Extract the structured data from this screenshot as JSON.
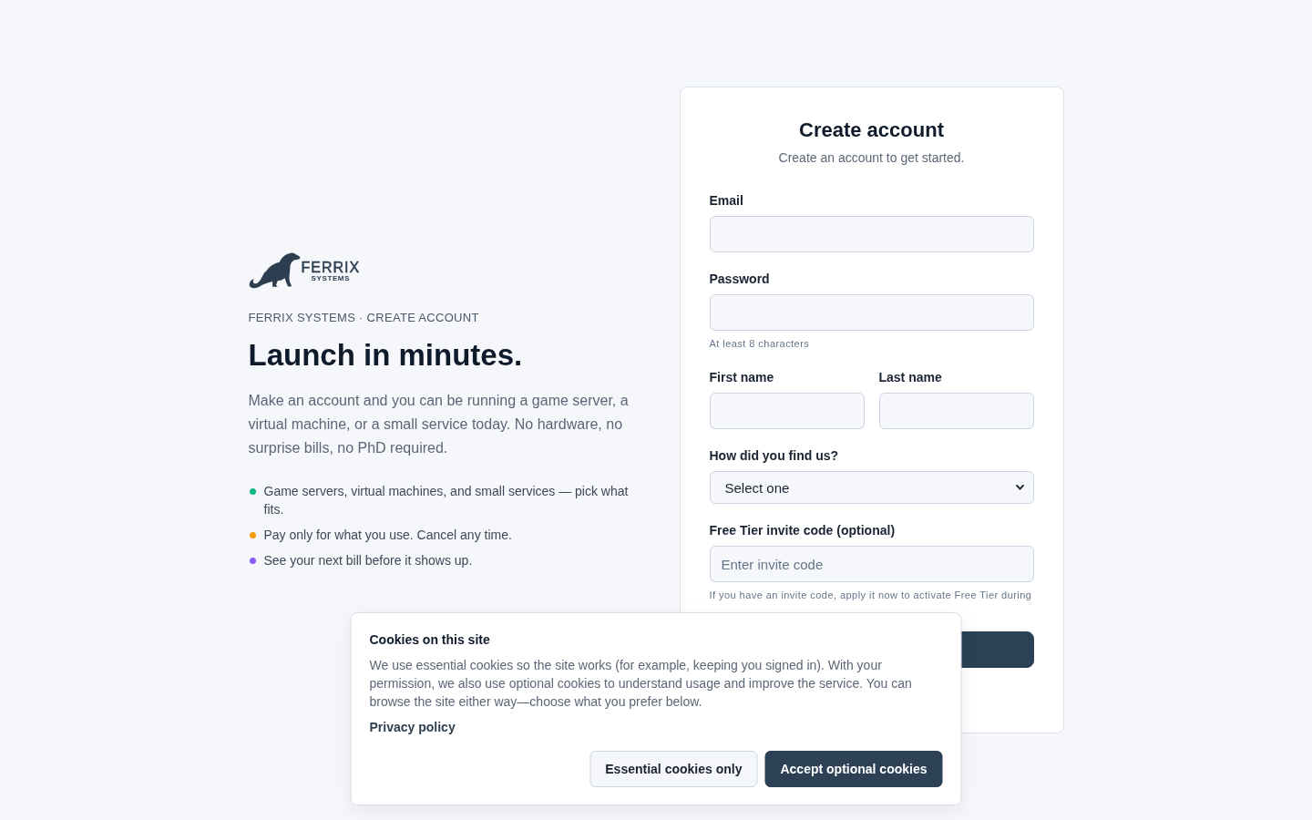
{
  "brand": {
    "logo": {
      "name": "FERRIX",
      "tagline": "SYSTEMS"
    },
    "eyebrow": "FERRIX SYSTEMS · CREATE ACCOUNT",
    "heading": "Launch in minutes.",
    "intro": "Make an account and you can be running a game server, a virtual machine, or a small service today. No hardware, no surprise bills, no PhD required.",
    "points": [
      {
        "text": "Game servers, virtual machines, and small services — pick what fits.",
        "color": "#10b981"
      },
      {
        "text": "Pay only for what you use. Cancel any time.",
        "color": "#f59e0b"
      },
      {
        "text": "See your next bill before it shows up.",
        "color": "#8b5cf6"
      }
    ]
  },
  "form": {
    "title": "Create account",
    "subtitle": "Create an account to get started.",
    "fields": [
      {
        "kind": "input",
        "label": "Email"
      },
      {
        "kind": "input",
        "label": "Password",
        "hint": "At least 8 characters"
      },
      {
        "kind": "pair",
        "fields": [
          {
            "kind": "input",
            "label": "First name"
          },
          {
            "kind": "input",
            "label": "Last name"
          }
        ]
      },
      {
        "kind": "select",
        "label": "How did you find us?",
        "value": "Select one"
      },
      {
        "kind": "input",
        "label": "Free Tier invite code (optional)",
        "placeholder": "Enter invite code",
        "hint": "If you have an invite code, apply it now to activate Free Tier during"
      }
    ],
    "submit": {
      "kind": "primary"
    }
  },
  "cookie_banner": {
    "title": "Cookies on this site",
    "body": "We use essential cookies so the site works (for example, keeping you signed in). With your permission, we also use optional cookies to understand usage and improve the service. You can browse the site either way—choose what you prefer below.",
    "link": "Privacy policy",
    "buttons": [
      {
        "label": "Essential cookies only",
        "kind": "secondary"
      },
      {
        "label": "Accept optional cookies",
        "kind": "primary"
      }
    ]
  }
}
